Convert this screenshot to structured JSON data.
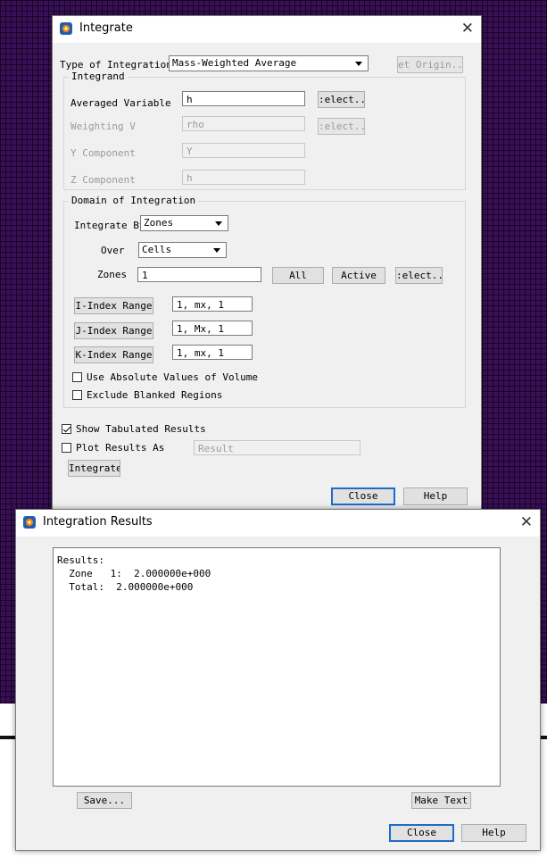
{
  "integrate": {
    "title": "Integrate",
    "type_label": "Type of Integration",
    "type_value": "Mass-Weighted Average",
    "set_origin": "et Origin..",
    "integrand": {
      "title": "Integrand",
      "averaged_label": "Averaged Variable",
      "averaged_value": "h",
      "select1": ":elect...",
      "weighting_label": "Weighting V",
      "weighting_value": "rho",
      "select2": ":elect...",
      "y_label": "Y Component",
      "y_value": "Y",
      "z_label": "Z Component",
      "z_value": "h"
    },
    "domain": {
      "title": "Domain of Integration",
      "by_label": "Integrate By",
      "by_value": "Zones",
      "over_label": "Over",
      "over_value": "Cells",
      "zones_label": "Zones",
      "zones_value": "1",
      "all_btn": "All",
      "active_btn": "Active",
      "select_btn": ":elect...",
      "i_btn": "I-Index Range",
      "i_value": "1, mx, 1",
      "j_btn": "J-Index Range",
      "j_value": "1, Mx, 1",
      "k_btn": "K-Index Range",
      "k_value": "1, mx, 1",
      "abs_label": "Use Absolute Values of Volume",
      "abs_checked": false,
      "excl_label": "Exclude Blanked Regions",
      "excl_checked": false
    },
    "show_tab_label": "Show Tabulated Results",
    "show_tab_checked": true,
    "plot_label": "Plot Results As",
    "plot_checked": false,
    "plot_value": "Result",
    "integrate_btn": "Integrate",
    "close_btn": "Close",
    "help_btn": "Help"
  },
  "results": {
    "title": "Integration Results",
    "lines": [
      "Results:",
      "  Zone   1:  2.000000e+000",
      "  Total:  2.000000e+000"
    ],
    "save_btn": "Save...",
    "make_text_btn": "Make Text",
    "close_btn": "Close",
    "help_btn": "Help"
  }
}
